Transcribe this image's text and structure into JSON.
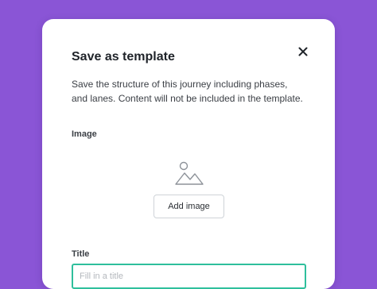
{
  "dialog": {
    "title": "Save as template",
    "description": "Save the structure of this journey including phases, and lanes. Content will not be included in the template.",
    "image_label": "Image",
    "add_image_button": "Add image",
    "title_label": "Title",
    "title_placeholder": "Fill in a title",
    "title_value": ""
  },
  "icons": {
    "close": "close-icon",
    "image_placeholder": "image-icon"
  },
  "colors": {
    "background": "#8a55d6",
    "input_focus_border": "#2fbf9c"
  }
}
